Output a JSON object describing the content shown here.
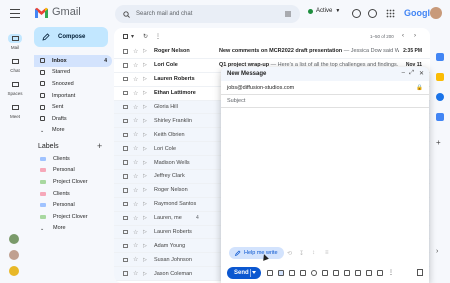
{
  "app": {
    "name": "Gmail",
    "search_placeholder": "Search mail and chat",
    "status": "Active",
    "brand": "Google"
  },
  "rail": [
    {
      "label": "Mail",
      "icon": "mail-icon"
    },
    {
      "label": "Chat",
      "icon": "chat-icon"
    },
    {
      "label": "Spaces",
      "icon": "spaces-icon"
    },
    {
      "label": "Meet",
      "icon": "meet-icon"
    }
  ],
  "sidebar": {
    "compose_label": "Compose",
    "items": [
      {
        "label": "Inbox",
        "count": "4"
      },
      {
        "label": "Starred",
        "count": ""
      },
      {
        "label": "Snoozed",
        "count": ""
      },
      {
        "label": "Important",
        "count": ""
      },
      {
        "label": "Sent",
        "count": ""
      },
      {
        "label": "Drafts",
        "count": ""
      },
      {
        "label": "More",
        "count": ""
      }
    ],
    "labels_title": "Labels",
    "labels": [
      {
        "label": "Clients",
        "color": "#a0c3ff"
      },
      {
        "label": "Personal",
        "color": "#f6a8b9"
      },
      {
        "label": "Project Clover",
        "color": "#a8d8a0"
      },
      {
        "label": "Clients",
        "color": "#f6a8b9"
      },
      {
        "label": "Personal",
        "color": "#a0c3ff"
      },
      {
        "label": "Project Clover",
        "color": "#a8d8a0"
      },
      {
        "label": "More",
        "color": ""
      }
    ]
  },
  "toolbar": {
    "range": "1–50 of 200"
  },
  "emails": [
    {
      "sender": "Roger Nelson",
      "subject": "New comments on MCR2022 draft presentation",
      "snippet": " — Jessica Dow said What a...",
      "time": "2:35 PM",
      "unread": true
    },
    {
      "sender": "Lori Cole",
      "subject": "Q1 project wrap-up",
      "snippet": " — Here's a list of all the top challenges and findings. Sure...",
      "time": "Nov 11",
      "unread": true
    },
    {
      "sender": "Lauren Roberts",
      "subject": "",
      "snippet": "",
      "time": "",
      "unread": true
    },
    {
      "sender": "Ethan Lattimore",
      "subject": "",
      "snippet": "",
      "time": "",
      "unread": true
    },
    {
      "sender": "Gloria Hill",
      "subject": "",
      "snippet": "",
      "time": "",
      "unread": false
    },
    {
      "sender": "Shirley Franklin",
      "subject": "",
      "snippet": "",
      "time": "",
      "unread": false
    },
    {
      "sender": "Keith Obrien",
      "subject": "",
      "snippet": "",
      "time": "",
      "unread": false
    },
    {
      "sender": "Lori Cole",
      "subject": "",
      "snippet": "",
      "time": "",
      "unread": false
    },
    {
      "sender": "Madison Wells",
      "subject": "",
      "snippet": "",
      "time": "",
      "unread": false
    },
    {
      "sender": "Jeffrey Clark",
      "subject": "",
      "snippet": "",
      "time": "",
      "unread": false
    },
    {
      "sender": "Roger Nelson",
      "subject": "",
      "snippet": "",
      "time": "",
      "unread": false
    },
    {
      "sender": "Raymond Santos",
      "subject": "",
      "snippet": "",
      "time": "",
      "unread": false
    },
    {
      "sender": "Lauren, me",
      "subject": "",
      "snippet": "",
      "time": "",
      "unread": false,
      "count": "4"
    },
    {
      "sender": "Lauren Roberts",
      "subject": "",
      "snippet": "",
      "time": "",
      "unread": false
    },
    {
      "sender": "Adam Young",
      "subject": "",
      "snippet": "",
      "time": "",
      "unread": false
    },
    {
      "sender": "Susan Johnson",
      "subject": "",
      "snippet": "",
      "time": "",
      "unread": false
    },
    {
      "sender": "Jason Coleman",
      "subject": "",
      "snippet": "",
      "time": "",
      "unread": false
    }
  ],
  "compose": {
    "title": "New Message",
    "to": "jobs@diffusion-studios.com",
    "subject_placeholder": "Subject",
    "help_me_write": "Help me write",
    "send_label": "Send"
  }
}
